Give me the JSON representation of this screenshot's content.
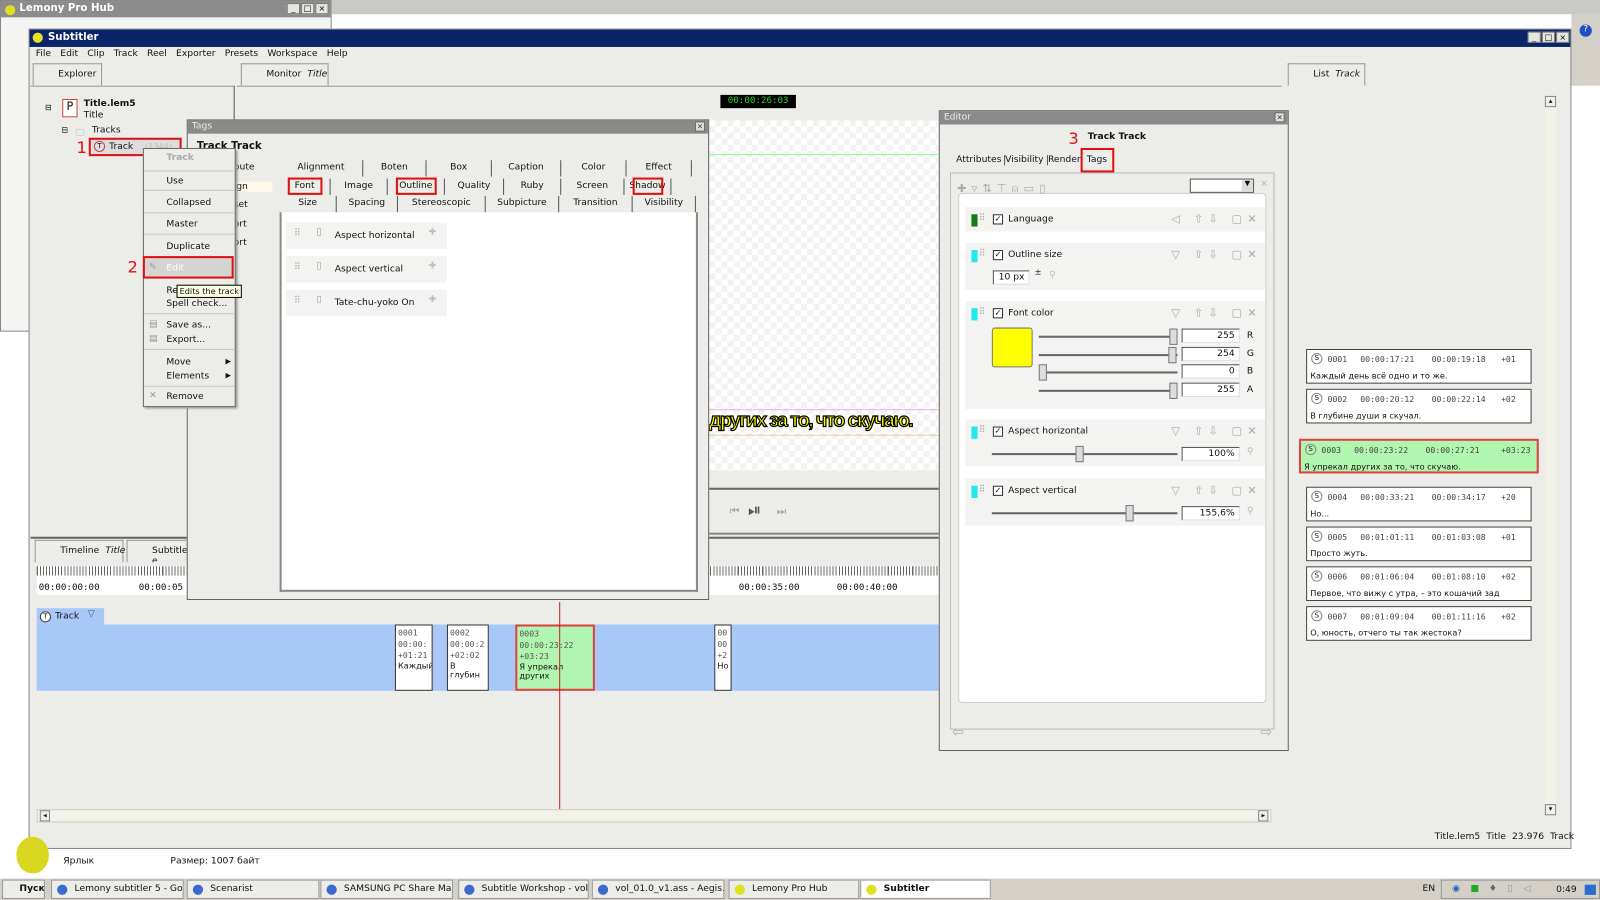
{
  "hub_window": {
    "title": "Lemony Pro Hub"
  },
  "app": {
    "title": "Subtitler",
    "menu": [
      "File",
      "Edit",
      "Clip",
      "Track",
      "Reel",
      "Exporter",
      "Presets",
      "Workspace",
      "Help"
    ]
  },
  "explorer": {
    "tab": "Explorer",
    "project": "Title.lem5",
    "project_sub": "Title",
    "folder": "Tracks",
    "track": "Track",
    "track_suffix": "(1344)"
  },
  "monitor": {
    "tab": "Monitor",
    "tab_sub": "Title",
    "timecode": "00:00:26:03",
    "subtitle_text": "других за то, что скучаю."
  },
  "annotations": {
    "n1": "1",
    "n2": "2",
    "n3": "3"
  },
  "context_menu": {
    "header": "Track",
    "items": [
      "Use",
      "Collapsed",
      "Master",
      "Duplicate",
      "Edit",
      "Rename...",
      "Spell check...",
      "Save as...",
      "Export...",
      "Move",
      "Elements",
      "Remove"
    ],
    "tooltip": "Edits the track"
  },
  "tags_dialog": {
    "title": "Tags",
    "heading": "Track Track",
    "left_fragments": [
      "bute",
      "ign",
      "set",
      "ort",
      "ort"
    ],
    "tab_rows": [
      [
        "Alignment",
        "Boten",
        "Box",
        "Caption",
        "Color",
        "Effect"
      ],
      [
        "Font",
        "Image",
        "Outline",
        "Quality",
        "Ruby",
        "Screen",
        "Shadow"
      ],
      [
        "Size",
        "Spacing",
        "Stereoscopic",
        "Subpicture",
        "Transition",
        "Visibility"
      ]
    ],
    "items": [
      "Aspect horizontal",
      "Aspect vertical",
      "Tate-chu-yoko On"
    ]
  },
  "editor": {
    "title": "Editor",
    "heading": "Track Track",
    "tabs": [
      "Attributes",
      "Visibility",
      "Render",
      "Tags"
    ],
    "active_tab": "Tags",
    "rows": {
      "language": {
        "label": "Language",
        "checked": true,
        "color": "#1a7a1a"
      },
      "outline": {
        "label": "Outline size",
        "checked": true,
        "value": "10 px",
        "color": "#22e8f0"
      },
      "font_color": {
        "label": "Font color",
        "checked": true,
        "swatch": "#ffff00",
        "r": "255",
        "g": "254",
        "b": "0",
        "a": "255",
        "labels": [
          "R",
          "G",
          "B",
          "A"
        ]
      },
      "aspect_h": {
        "label": "Aspect horizontal",
        "checked": true,
        "value": "100%",
        "slider": 0.47
      },
      "aspect_v": {
        "label": "Aspect vertical",
        "checked": true,
        "value": "155,6%",
        "slider": 0.75
      }
    }
  },
  "list": {
    "tab": "List",
    "tab_sub": "Track",
    "subtitles": [
      {
        "id": "0001",
        "start": "00:00:17:21",
        "end": "00:00:19:18",
        "dur": "+01",
        "text": "Каждый день всё одно и то же."
      },
      {
        "id": "0002",
        "start": "00:00:20:12",
        "end": "00:00:22:14",
        "dur": "+02",
        "text": "В глубине души я скучал."
      },
      {
        "id": "0003",
        "start": "00:00:23:22",
        "end": "00:00:27:21",
        "dur": "+03:23",
        "text": "Я упрекал других за то, что скучаю.",
        "selected": true
      },
      {
        "id": "0004",
        "start": "00:00:33:21",
        "end": "00:00:34:17",
        "dur": "+20",
        "text": "Но..."
      },
      {
        "id": "0005",
        "start": "00:01:01:11",
        "end": "00:01:03:08",
        "dur": "+01",
        "text": "Просто жуть."
      },
      {
        "id": "0006",
        "start": "00:01:06:04",
        "end": "00:01:08:10",
        "dur": "+02",
        "text": "Первое, что вижу с утра, – это кошачий зад"
      },
      {
        "id": "0007",
        "start": "00:01:09:04",
        "end": "00:01:11:16",
        "dur": "+02",
        "text": "О, юность, отчего ты так жестока?"
      }
    ]
  },
  "timeline": {
    "tab": "Timeline",
    "tab_sub": "Title",
    "tab2": "Subtitle e",
    "ticks": [
      "00:00:00:00",
      "00:00:05",
      "00:00:35:00",
      "00:00:40:00"
    ],
    "track": "Track",
    "clips": [
      {
        "id": "0001",
        "tc": "00:00:",
        "dur": "+01:21",
        "text": "Каждый"
      },
      {
        "id": "0002",
        "tc": "00:00:2",
        "dur": "+02:02",
        "text": "В глубин"
      },
      {
        "id": "0003",
        "tc": "00:00:23:22",
        "dur": "+03:23",
        "text": "Я упрекал других"
      },
      {
        "id": "00",
        "tc": "00",
        "dur": "+2",
        "text": "Но"
      }
    ]
  },
  "statusbar": {
    "file": "Title.lem5",
    "title": "Title",
    "fps": "23.976",
    "track": "Track"
  },
  "desktop": {
    "label": "Ярлык",
    "size": "Размер: 1007 байт"
  },
  "taskbar": {
    "start": "Пуск",
    "tasks": [
      "Lemony subtitler 5 - Goo...",
      "Scenarist",
      "SAMSUNG PC Share Man...",
      "Subtitle Workshop - vol_...",
      "vol_01.0_v1.ass - Aegis...",
      "Lemony Pro Hub",
      "Subtitler"
    ],
    "lang": "EN",
    "clock": "0:49"
  }
}
